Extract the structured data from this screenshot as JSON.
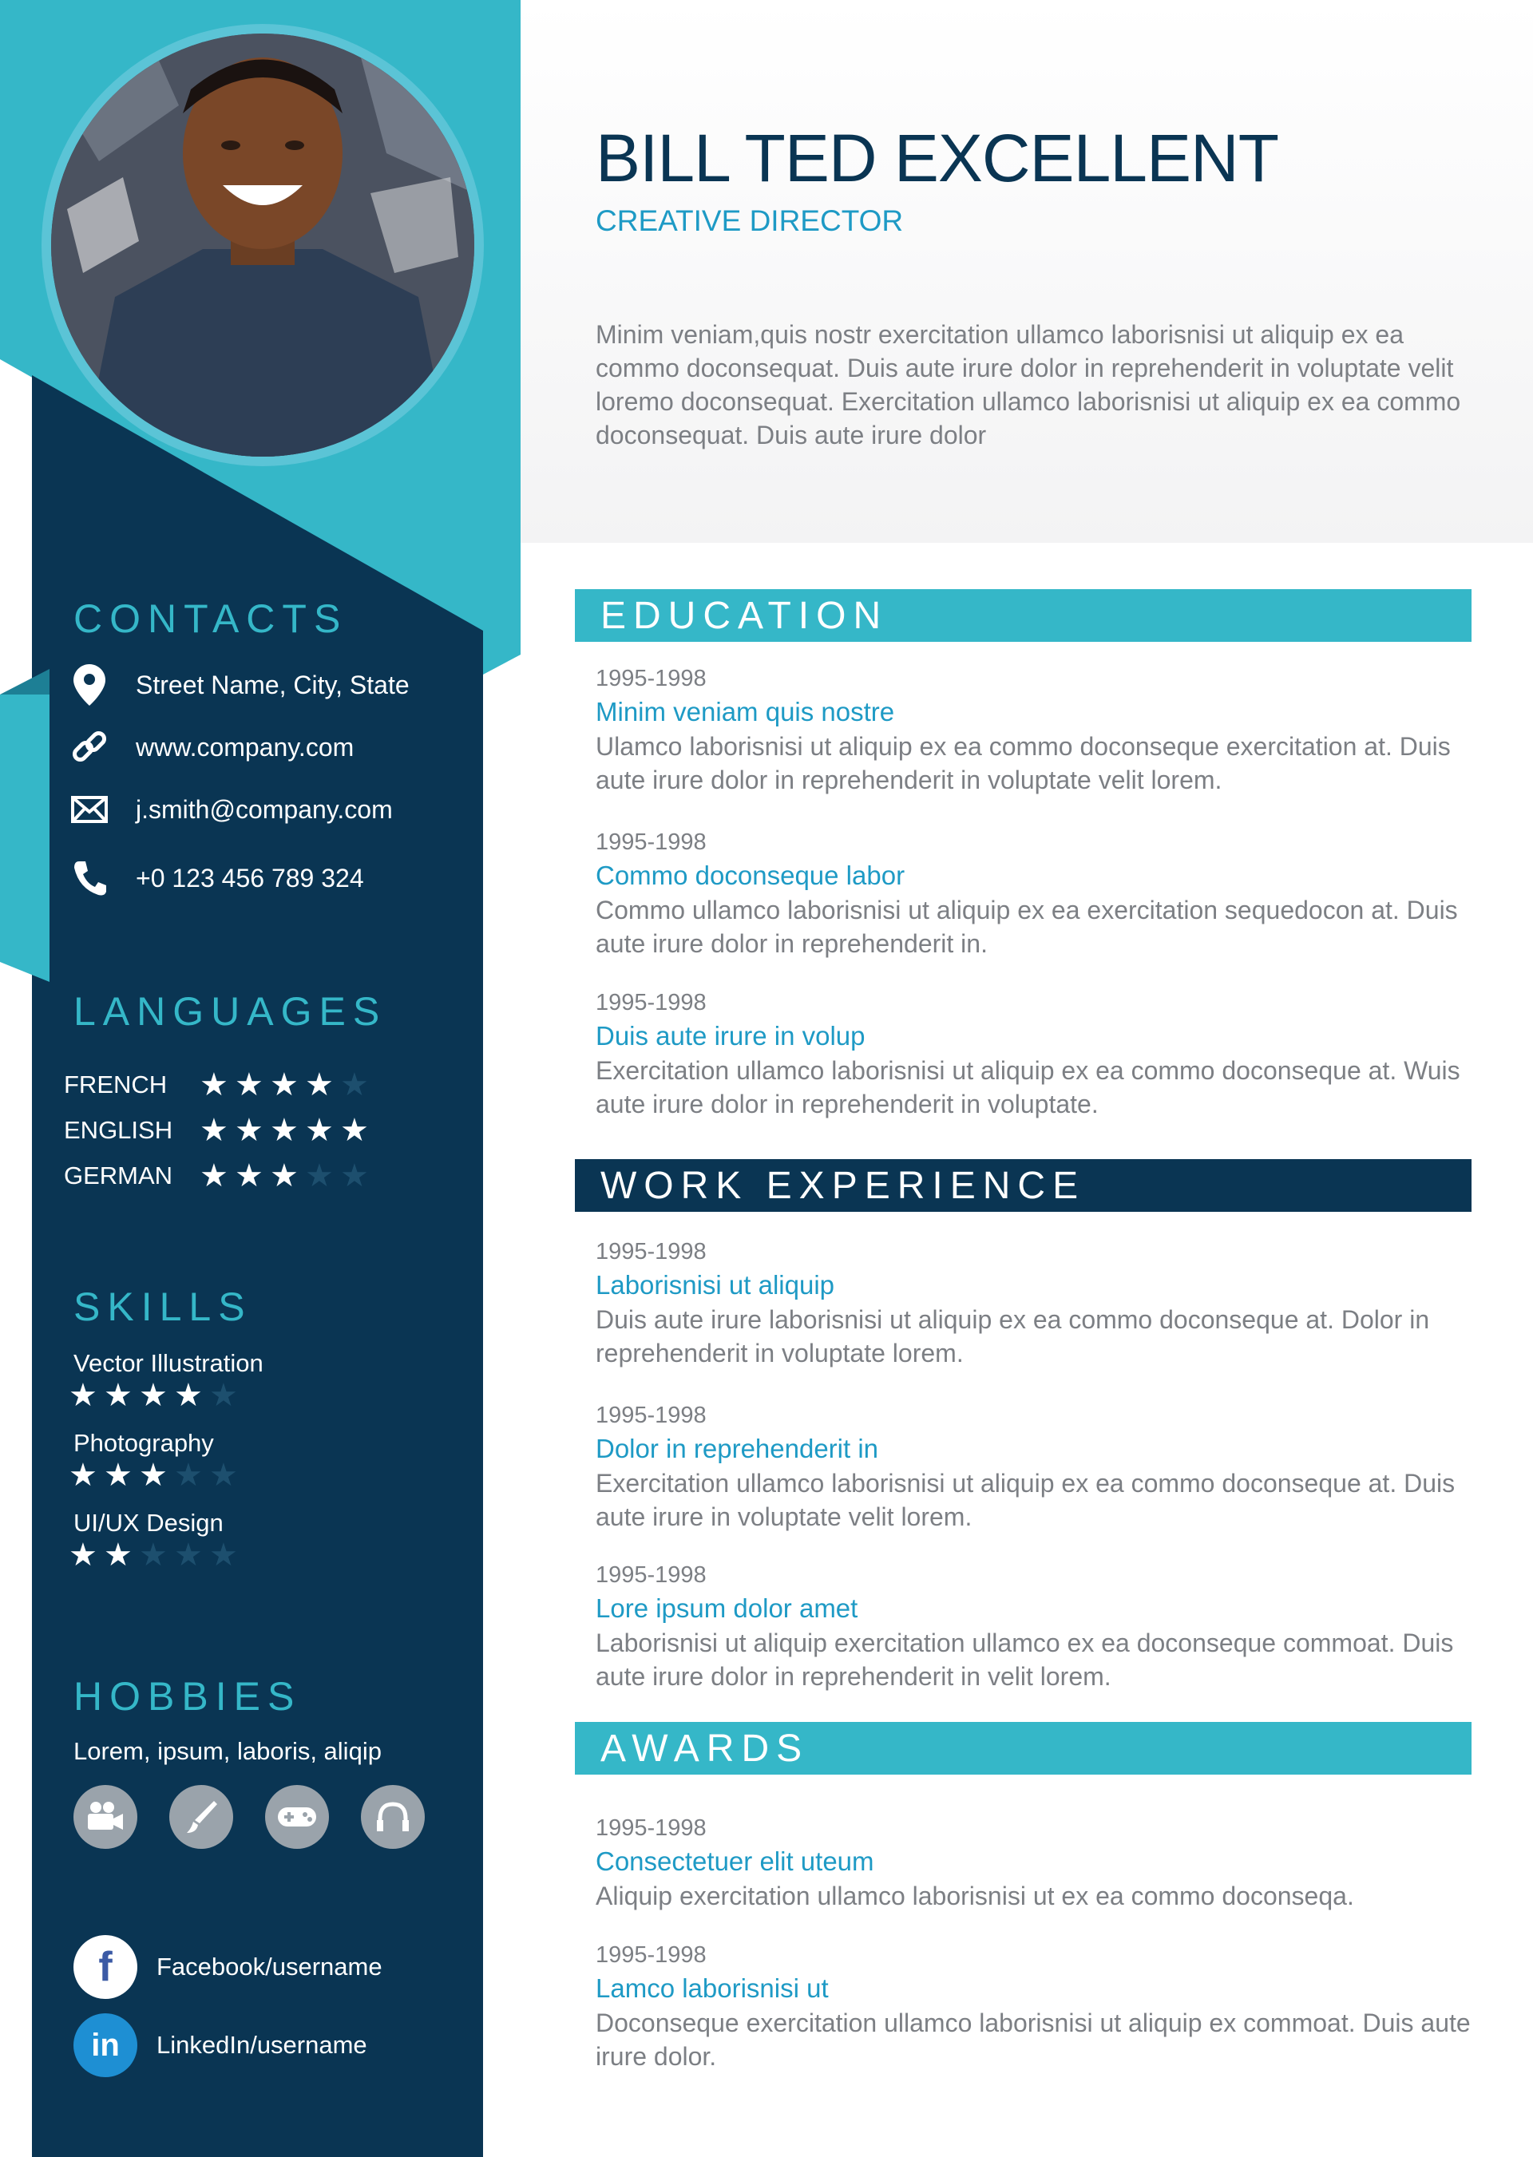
{
  "header": {
    "name": "BILL TED EXCELLENT",
    "role": "CREATIVE DIRECTOR",
    "intro": "Minim veniam,quis nostr exercitation ullamco laborisnisi ut aliquip ex ea commo doconsequat. Duis aute irure dolor in reprehenderit in voluptate velit loremo doconsequat. Exercitation ullamco laborisnisi ut aliquip ex ea commo doconsequat. Duis aute irure dolor"
  },
  "contacts": {
    "title": "CONTACTS",
    "items": [
      {
        "icon": "location-pin-icon",
        "text": "Street Name, City, State"
      },
      {
        "icon": "link-icon",
        "text": "www.company.com"
      },
      {
        "icon": "envelope-icon",
        "text": "j.smith@company.com"
      },
      {
        "icon": "phone-icon",
        "text": "+0 123 456 789 324"
      }
    ]
  },
  "languages": {
    "title": "LANGUAGES",
    "items": [
      {
        "name": "FRENCH",
        "rating": 4,
        "max": 5
      },
      {
        "name": "ENGLISH",
        "rating": 5,
        "max": 5
      },
      {
        "name": "GERMAN",
        "rating": 3,
        "max": 5
      }
    ]
  },
  "skills": {
    "title": "SKILLS",
    "items": [
      {
        "name": "Vector Illustration",
        "rating": 4,
        "max": 5
      },
      {
        "name": "Photography",
        "rating": 3,
        "max": 5
      },
      {
        "name": "UI/UX Design",
        "rating": 2,
        "max": 5
      }
    ]
  },
  "hobbies": {
    "title": "HOBBIES",
    "text": "Lorem, ipsum, laboris, aliqip",
    "icons": [
      "video-camera-icon",
      "brush-icon",
      "gamepad-icon",
      "headphones-icon"
    ]
  },
  "social": [
    {
      "icon": "facebook-icon",
      "glyph": "f",
      "text": "Facebook/username"
    },
    {
      "icon": "linkedin-icon",
      "glyph": "in",
      "text": "LinkedIn/username"
    }
  ],
  "education": {
    "title": "EDUCATION",
    "entries": [
      {
        "years": "1995-1998",
        "title": "Minim veniam quis nostre",
        "desc": "Ulamco laborisnisi ut aliquip ex ea commo doconseque exercitation at. Duis aute irure dolor in reprehenderit in voluptate velit lorem."
      },
      {
        "years": "1995-1998",
        "title": "Commo doconseque labor",
        "desc": "Commo ullamco laborisnisi ut aliquip ex ea exercitation sequedocon at. Duis aute irure dolor in reprehenderit in."
      },
      {
        "years": "1995-1998",
        "title": "Duis aute irure in volup",
        "desc": "Exercitation ullamco laborisnisi ut aliquip ex ea commo doconseque at. Wuis aute irure dolor in reprehenderit in voluptate."
      }
    ]
  },
  "work": {
    "title": "WORK EXPERIENCE",
    "entries": [
      {
        "years": "1995-1998",
        "title": "Laborisnisi ut aliquip",
        "desc": "Duis aute irure laborisnisi ut aliquip ex ea commo doconseque at. Dolor in reprehenderit in voluptate lorem."
      },
      {
        "years": "1995-1998",
        "title": "Dolor in reprehenderit in",
        "desc": "Exercitation ullamco laborisnisi ut aliquip ex ea commo doconseque at. Duis aute irure in voluptate velit lorem."
      },
      {
        "years": "1995-1998",
        "title": "Lore ipsum dolor amet",
        "desc": "Laborisnisi ut aliquip exercitation ullamco  ex ea doconseque commoat. Duis aute irure dolor in reprehenderit in velit lorem."
      }
    ]
  },
  "awards": {
    "title": "AWARDS",
    "entries": [
      {
        "years": "1995-1998",
        "title": "Consectetuer elit uteum",
        "desc": "Aliquip exercitation ullamco laborisnisi ut ex ea commo doconseqa."
      },
      {
        "years": "1995-1998",
        "title": "Lamco laborisnisi ut",
        "desc": "Doconseque exercitation ullamco laborisnisi ut aliquip ex commoat. Duis aute irure dolor."
      }
    ]
  },
  "colors": {
    "navy": "#0a3553",
    "teal": "#35b7c8",
    "accent_text": "#1e9ac5",
    "body_text": "#7c7f84"
  }
}
